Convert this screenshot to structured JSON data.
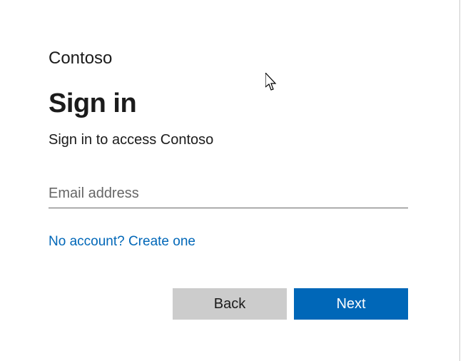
{
  "org_name": "Contoso",
  "title": "Sign in",
  "subtitle": "Sign in to access Contoso",
  "email": {
    "placeholder": "Email address",
    "value": ""
  },
  "create_link": "No account? Create one",
  "buttons": {
    "back": "Back",
    "next": "Next"
  },
  "colors": {
    "primary": "#0067b8",
    "secondary": "#cccccc"
  }
}
